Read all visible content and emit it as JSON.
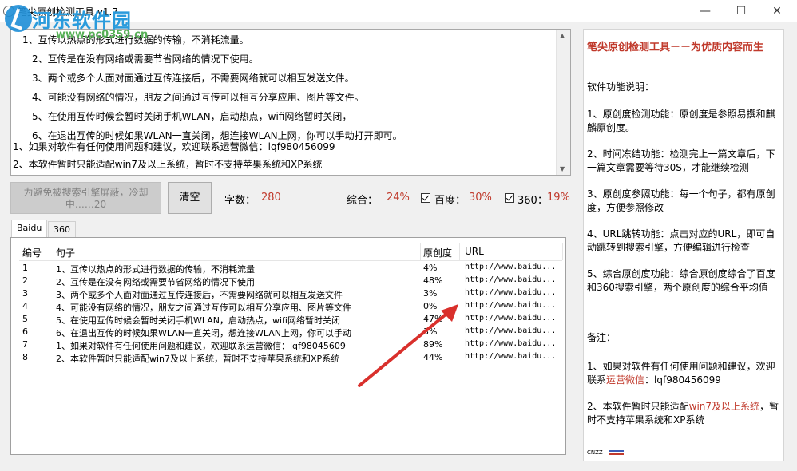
{
  "window": {
    "title": "笔尖原创检测工具 v1.7",
    "minimize": "—",
    "maximize": "☐",
    "close": "✕"
  },
  "watermark": {
    "name": "河东软件园",
    "url": "www.pc0359.cn"
  },
  "info_lines": [
    "1、互传以热点的形式进行数据的传输，不消耗流量。",
    "2、互传是在没有网络或需要节省网络的情况下使用。",
    "3、两个或多个人面对面通过互传连接后，不需要网络就可以相互发送文件。",
    "4、可能没有网络的情况，朋友之间通过互传可以相互分享应用、图片等文件。",
    "5、在使用互传时候会暂时关闭手机WLAN，启动热点，wifi网络暂时关闭，",
    "6、在退出互传的时候如果WLAN一直关闭，想连接WLAN上网，你可以手动打开即可。",
    "1、如果对软件有任何使用问题和建议，欢迎联系运营微信：lqf980456099",
    "2、本软件暂时只能适配win7及以上系统，暂时不支持苹果系统和XP系统"
  ],
  "toolbar": {
    "detect_button": "为避免被搜索引擎屏蔽，冷却中……20",
    "clear_button": "清空",
    "char_count_label": "字数：",
    "char_count_value": "280",
    "overall_label": "综合：",
    "overall_value": "24%",
    "baidu_label": "百度：",
    "baidu_value": "30%",
    "s360_label": "360：",
    "s360_value": "19%"
  },
  "tabs": [
    "Baidu",
    "360"
  ],
  "table": {
    "headers": [
      "编号",
      "句子",
      "原创度",
      "URL"
    ],
    "rows": [
      {
        "no": "1",
        "sentence": "1、互传以热点的形式进行数据的传输，不消耗流量",
        "orig": "4%",
        "url": "http://www.baidu..."
      },
      {
        "no": "2",
        "sentence": "2、互传是在没有网络或需要节省网络的情况下使用",
        "orig": "48%",
        "url": "http://www.baidu..."
      },
      {
        "no": "3",
        "sentence": "3、两个或多个人面对面通过互传连接后，不需要网络就可以相互发送文件",
        "orig": "3%",
        "url": "http://www.baidu..."
      },
      {
        "no": "4",
        "sentence": "4、可能没有网络的情况，朋友之间通过互传可以相互分享应用、图片等文件",
        "orig": "0%",
        "url": "http://www.baidu..."
      },
      {
        "no": "5",
        "sentence": "5、在使用互传时候会暂时关闭手机WLAN，启动热点，wifi网络暂时关闭",
        "orig": "47%",
        "url": "http://www.baidu..."
      },
      {
        "no": "6",
        "sentence": "6、在退出互传的时候如果WLAN一直关闭，想连接WLAN上网，你可以手动",
        "orig": "3%",
        "url": "http://www.baidu..."
      },
      {
        "no": "7",
        "sentence": "1、如果对软件有任何使用问题和建议，欢迎联系运营微信：lqf98045609",
        "orig": "89%",
        "url": "http://www.baidu..."
      },
      {
        "no": "8",
        "sentence": "2、本软件暂时只能适配win7及以上系统，暂时不支持苹果系统和XP系统",
        "orig": "44%",
        "url": "http://www.baidu..."
      }
    ]
  },
  "side": {
    "title": "笔尖原创检测工具－－为优质内容而生",
    "features_heading": "软件功能说明：",
    "f1": "1、原创度检测功能：原创度是参照易撰和麒麟原创度。",
    "f2": "2、时间冻结功能：检测完上一篇文章后，下一篇文章需要等待30S，才能继续检测",
    "f3": "3、原创度参照功能：每一个句子，都有原创度，方便参照修改",
    "f4": "4、URL跳转功能：点击对应的URL，即可自动跳转到搜索引擎，方便编辑进行检查",
    "f5": "5、综合原创度功能：综合原创度综合了百度和360搜索引擎，两个原创度的综合平均值",
    "notes_heading": "备注：",
    "n1_pre": "1、如果对软件有任何使用问题和建议，欢迎联系",
    "n1_hl": "运营微信",
    "n1_post": "：lqf980456099",
    "n2_pre": "2、本软件暂时只能适配",
    "n2_hl": "win7及以上系统",
    "n2_post": "，暂时不支持苹果系统和XP系统",
    "footer_logo": "CNZZ"
  },
  "colors": {
    "accent_red": "#c0392b",
    "arrow_red": "#d9302c"
  }
}
